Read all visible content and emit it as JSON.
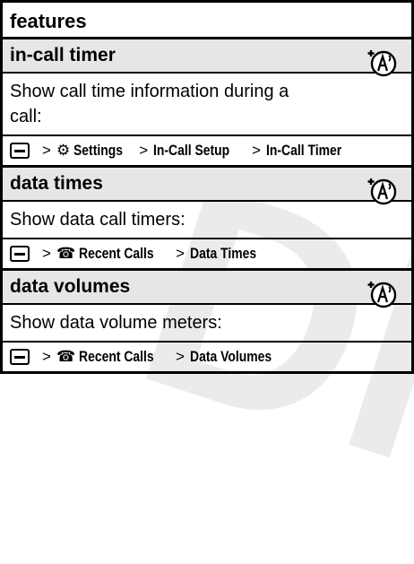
{
  "header": {
    "title": "features"
  },
  "watermark": "DR",
  "features": [
    {
      "name": "in-call timer",
      "description": "Show call time information during a call:",
      "path": [
        {
          "icon": "settings-icon",
          "label": "Settings"
        },
        {
          "label": "In-Call Setup"
        },
        {
          "label": "In-Call Timer"
        }
      ]
    },
    {
      "name": "data times",
      "description": "Show data call timers:",
      "path": [
        {
          "icon": "recent-calls-icon",
          "label": "Recent Calls"
        },
        {
          "label": "Data Times"
        }
      ]
    },
    {
      "name": "data volumes",
      "description": "Show data volume meters:",
      "path": [
        {
          "icon": "recent-calls-icon",
          "label": "Recent Calls"
        },
        {
          "label": "Data Volumes"
        }
      ]
    }
  ],
  "path_separator": ">",
  "icons": {
    "network_dependent": "network-feature-icon",
    "menu_key": "menu-key-icon"
  }
}
